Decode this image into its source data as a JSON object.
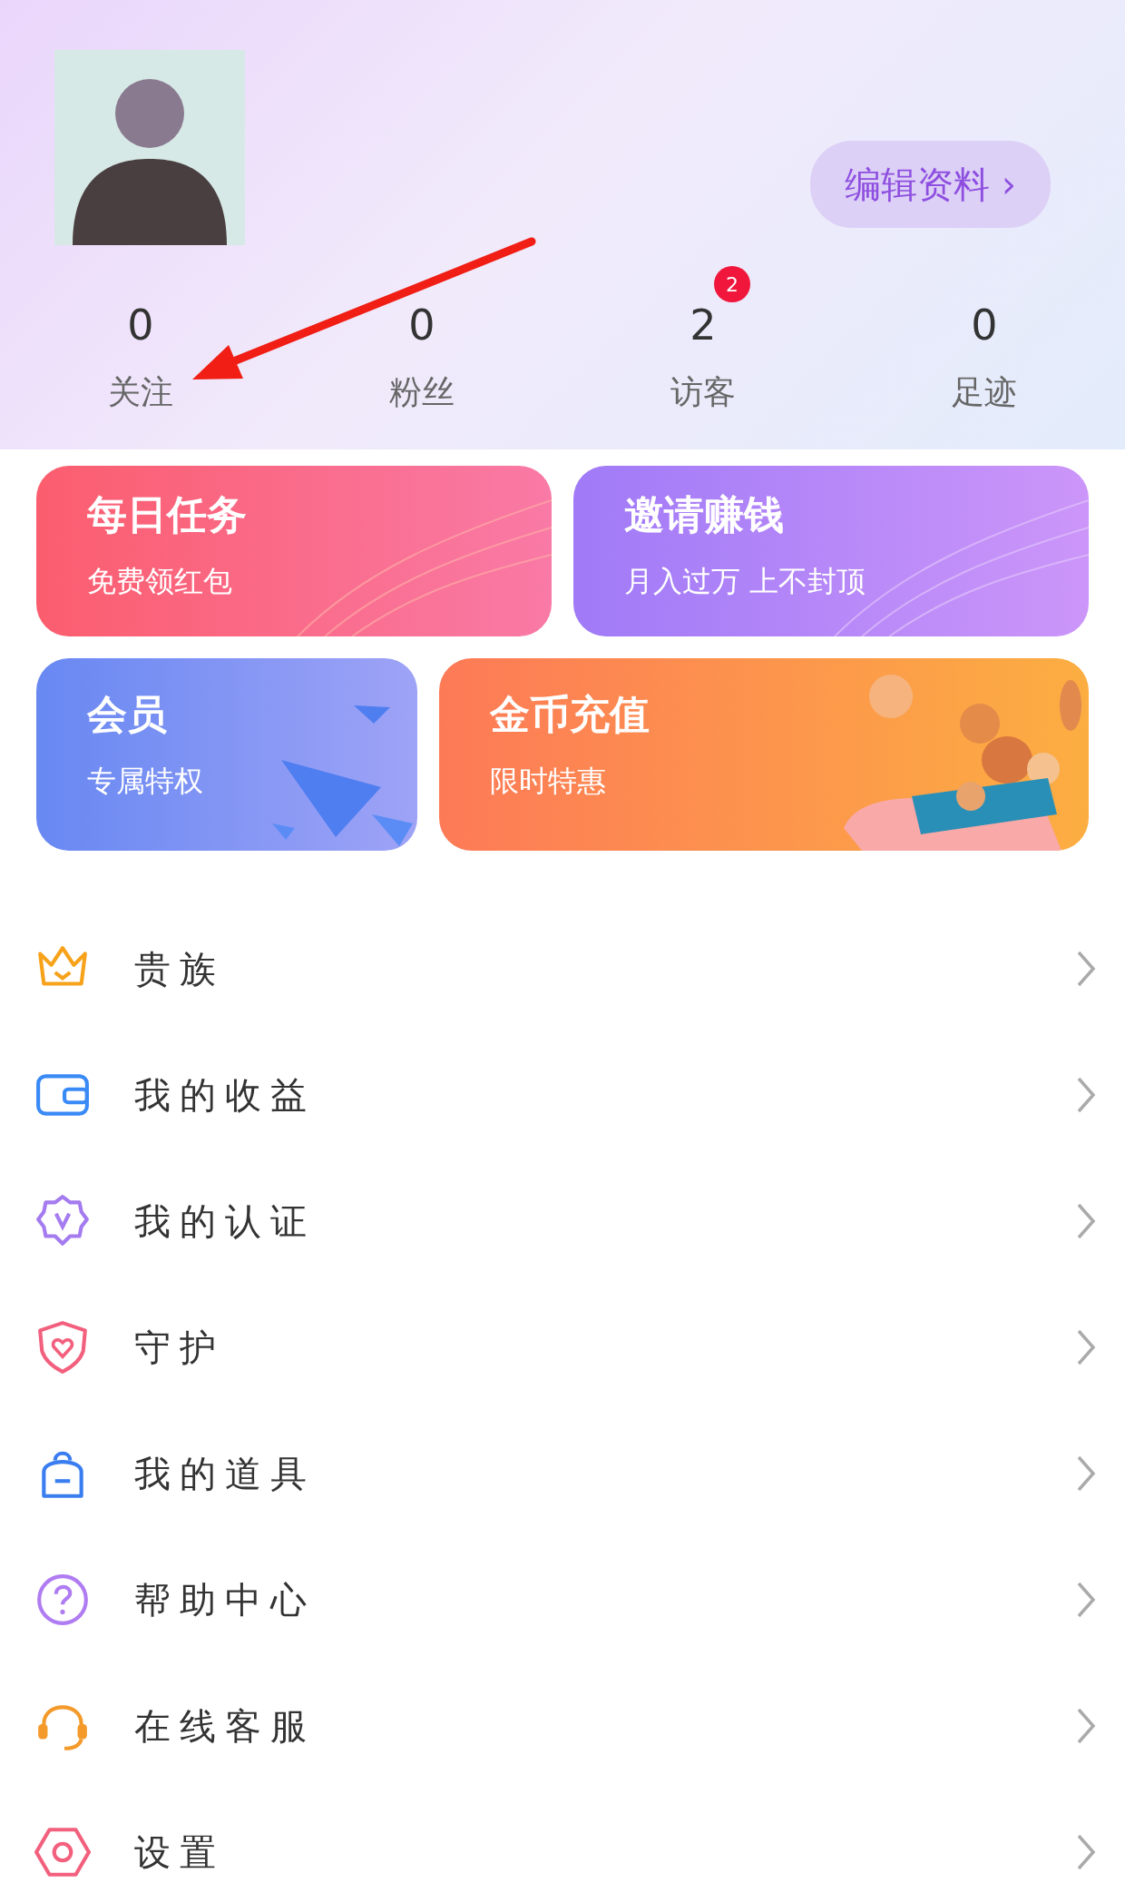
{
  "header": {
    "edit_button": "编辑资料 ›"
  },
  "stats": [
    {
      "value": "0",
      "label": "关注"
    },
    {
      "value": "0",
      "label": "粉丝"
    },
    {
      "value": "2",
      "label": "访客",
      "badge": "2"
    },
    {
      "value": "0",
      "label": "足迹"
    }
  ],
  "cards": [
    {
      "title": "每日任务",
      "subtitle": "免费领红包"
    },
    {
      "title": "邀请赚钱",
      "subtitle": "月入过万 上不封顶"
    },
    {
      "title": "会员",
      "subtitle": "专属特权"
    },
    {
      "title": "金币充值",
      "subtitle": "限时特惠"
    }
  ],
  "menu": [
    {
      "label": "贵族"
    },
    {
      "label": "我的收益"
    },
    {
      "label": "我的认证"
    },
    {
      "label": "守护"
    },
    {
      "label": "我的道具"
    },
    {
      "label": "帮助中心"
    },
    {
      "label": "在线客服"
    },
    {
      "label": "设置"
    }
  ]
}
